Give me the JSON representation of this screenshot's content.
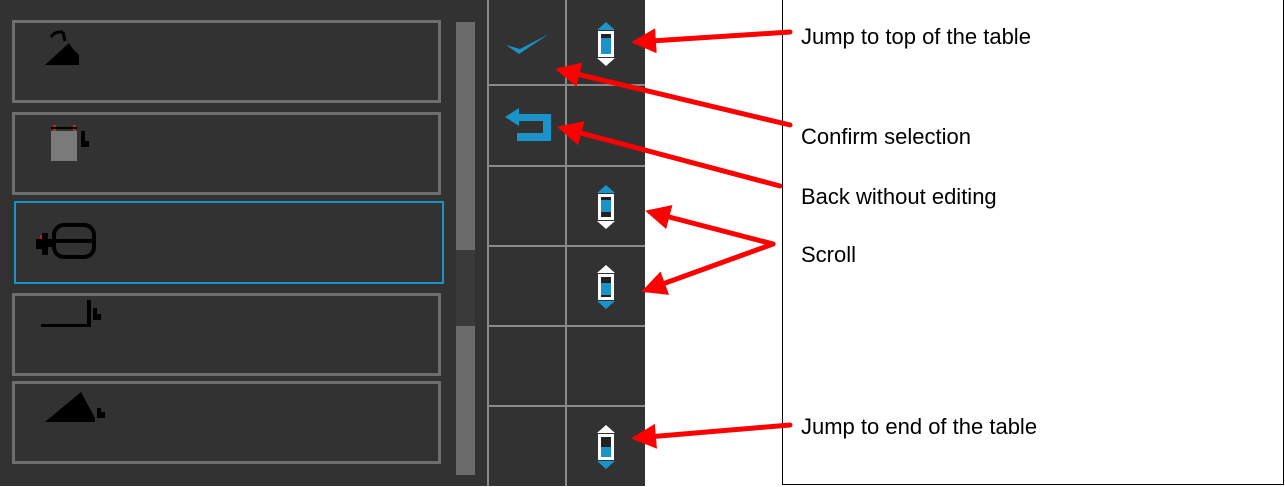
{
  "annotations": {
    "top": "Jump to top of the table",
    "confirm": "Confirm selection",
    "back": "Back without editing",
    "scroll": "Scroll",
    "end": "Jump to end of the table"
  },
  "list": {
    "items": [
      "grading-blade",
      "counterweight",
      "mulcher-head",
      "pallet-fork",
      "front-loader"
    ],
    "selected_index": 2
  },
  "colors": {
    "accent": "#1a93c9",
    "arrow": "#ff0000",
    "panel": "#323232"
  }
}
